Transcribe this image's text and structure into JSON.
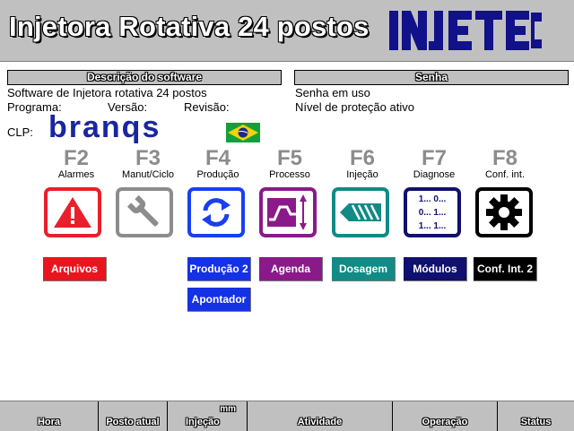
{
  "header": {
    "title": "Injetora Rotativa 24 postos",
    "logo_text": "INJETEC"
  },
  "software": {
    "section_title": "Descrição do software",
    "line1": "Software de Injetora rotativa 24 postos",
    "programa_label": "Programa:",
    "versao_label": "Versão:",
    "revisao_label": "Revisão:",
    "clp_label": "CLP:",
    "clp_brand": "branqs"
  },
  "senha": {
    "section_title": "Senha",
    "line1": "Senha em uso",
    "line2": "Nível de proteção ativo"
  },
  "function_keys": [
    {
      "key": "F2",
      "label": "Alarmes",
      "color": "#e8202a",
      "icon": "warning-icon"
    },
    {
      "key": "F3",
      "label": "Manut/Ciclo",
      "color": "#8c8c8c",
      "icon": "wrench-icon"
    },
    {
      "key": "F4",
      "label": "Produção",
      "color": "#1a3ff0",
      "icon": "refresh-icon"
    },
    {
      "key": "F5",
      "label": "Processo",
      "color": "#8a1a8a",
      "icon": "process-profile-icon"
    },
    {
      "key": "F6",
      "label": "Injeção",
      "color": "#128a86",
      "icon": "screw-icon"
    },
    {
      "key": "F7",
      "label": "Diagnose",
      "color": "#10106e",
      "icon": "binary-icon"
    },
    {
      "key": "F8",
      "label": "Conf. int.",
      "color": "#000000",
      "icon": "gear-icon"
    }
  ],
  "diagnose_icon_text": {
    "row1": "1... 0...",
    "row2": "0... 1...",
    "row3": "1... 1..."
  },
  "sub_buttons": {
    "arquivos": "Arquivos",
    "producao2": "Produção 2",
    "apontador": "Apontador",
    "agenda": "Agenda",
    "dosagem": "Dosagem",
    "modulos": "Módulos",
    "conf_int2": "Conf. Int. 2"
  },
  "status_bar": {
    "hora": "Hora",
    "posto_atual": "Posto atual",
    "injecao": "Injeção",
    "injecao_unit": "mm",
    "atividade": "Atividade",
    "operacao": "Operação",
    "status": "Status"
  },
  "colors": {
    "header_bg": "#c0c0c0",
    "alarm_red": "#e8202a",
    "production_blue": "#1a3ff0",
    "process_purple": "#8a1a8a",
    "teal": "#128a86",
    "navy": "#10106e"
  }
}
